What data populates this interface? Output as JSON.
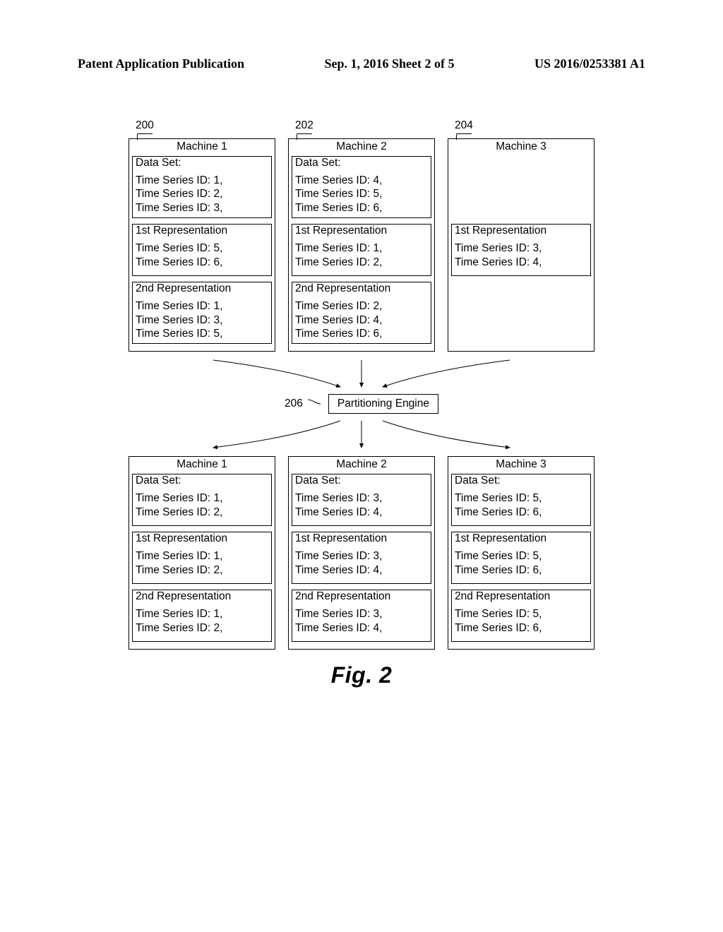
{
  "header": {
    "left": "Patent Application Publication",
    "center": "Sep. 1, 2016  Sheet 2 of 5",
    "right": "US 2016/0253381 A1"
  },
  "ref": {
    "m1": "200",
    "m2": "202",
    "m3": "204",
    "engine": "206"
  },
  "top": {
    "m1": {
      "title": "Machine 1",
      "ds_label": "Data Set:",
      "ds_items": [
        "Time Series ID: 1,",
        "Time Series ID: 2,",
        "Time Series ID: 3,"
      ],
      "r1_label": "1st Representation",
      "r1_items": [
        "Time Series ID: 5,",
        "Time Series ID: 6,"
      ],
      "r2_label": "2nd Representation",
      "r2_items": [
        "Time Series ID: 1,",
        "Time Series ID: 3,",
        "Time Series ID: 5,"
      ]
    },
    "m2": {
      "title": "Machine 2",
      "ds_label": "Data Set:",
      "ds_items": [
        "Time Series ID: 4,",
        "Time Series ID: 5,",
        "Time Series ID: 6,"
      ],
      "r1_label": "1st Representation",
      "r1_items": [
        "Time Series ID: 1,",
        "Time Series ID: 2,"
      ],
      "r2_label": "2nd Representation",
      "r2_items": [
        "Time Series ID: 2,",
        "Time Series ID: 4,",
        "Time Series ID: 6,"
      ]
    },
    "m3": {
      "title": "Machine 3",
      "r1_label": "1st Representation",
      "r1_items": [
        "Time Series ID: 3,",
        "Time Series ID: 4,"
      ]
    }
  },
  "engine_label": "Partitioning Engine",
  "bottom": {
    "m1": {
      "title": "Machine 1",
      "ds_label": "Data Set:",
      "ds_items": [
        "Time Series ID: 1,",
        "Time Series ID: 2,"
      ],
      "r1_label": "1st Representation",
      "r1_items": [
        "Time Series ID: 1,",
        "Time Series ID: 2,"
      ],
      "r2_label": "2nd Representation",
      "r2_items": [
        "Time Series ID: 1,",
        "Time Series ID: 2,"
      ]
    },
    "m2": {
      "title": "Machine 2",
      "ds_label": "Data Set:",
      "ds_items": [
        "Time Series ID: 3,",
        "Time Series ID: 4,"
      ],
      "r1_label": "1st Representation",
      "r1_items": [
        "Time Series ID: 3,",
        "Time Series ID: 4,"
      ],
      "r2_label": "2nd Representation",
      "r2_items": [
        "Time Series ID: 3,",
        "Time Series ID: 4,"
      ]
    },
    "m3": {
      "title": "Machine 3",
      "ds_label": "Data Set:",
      "ds_items": [
        "Time Series ID: 5,",
        "Time Series ID: 6,"
      ],
      "r1_label": "1st Representation",
      "r1_items": [
        "Time Series ID: 5,",
        "Time Series ID: 6,"
      ],
      "r2_label": "2nd Representation",
      "r2_items": [
        "Time Series ID: 5,",
        "Time Series ID: 6,"
      ]
    }
  },
  "figure_label": "Fig. 2"
}
